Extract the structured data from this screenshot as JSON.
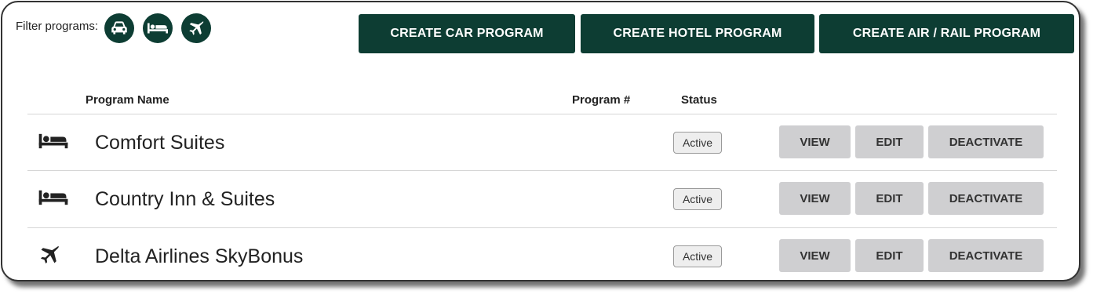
{
  "filter": {
    "label": "Filter programs:",
    "buttons": [
      {
        "icon": "car-icon"
      },
      {
        "icon": "bed-icon"
      },
      {
        "icon": "airplane-icon"
      }
    ]
  },
  "actions": {
    "create_car": "CREATE CAR PROGRAM",
    "create_hotel": "CREATE HOTEL PROGRAM",
    "create_air_rail": "CREATE AIR / RAIL PROGRAM"
  },
  "table": {
    "headers": {
      "name": "Program Name",
      "number": "Program #",
      "status": "Status"
    },
    "rows": [
      {
        "icon": "bed-icon",
        "name": "Comfort Suites",
        "number": "",
        "status": "Active",
        "view": "VIEW",
        "edit": "EDIT",
        "deactivate": "DEACTIVATE"
      },
      {
        "icon": "bed-icon",
        "name": "Country Inn & Suites",
        "number": "",
        "status": "Active",
        "view": "VIEW",
        "edit": "EDIT",
        "deactivate": "DEACTIVATE"
      },
      {
        "icon": "airplane-icon",
        "name": "Delta Airlines SkyBonus",
        "number": "",
        "status": "Active",
        "view": "VIEW",
        "edit": "EDIT",
        "deactivate": "DEACTIVATE"
      }
    ]
  },
  "colors": {
    "primary": "#0d3d33",
    "secondary_button": "#cfcfd1",
    "divider": "#d6d6d6"
  }
}
